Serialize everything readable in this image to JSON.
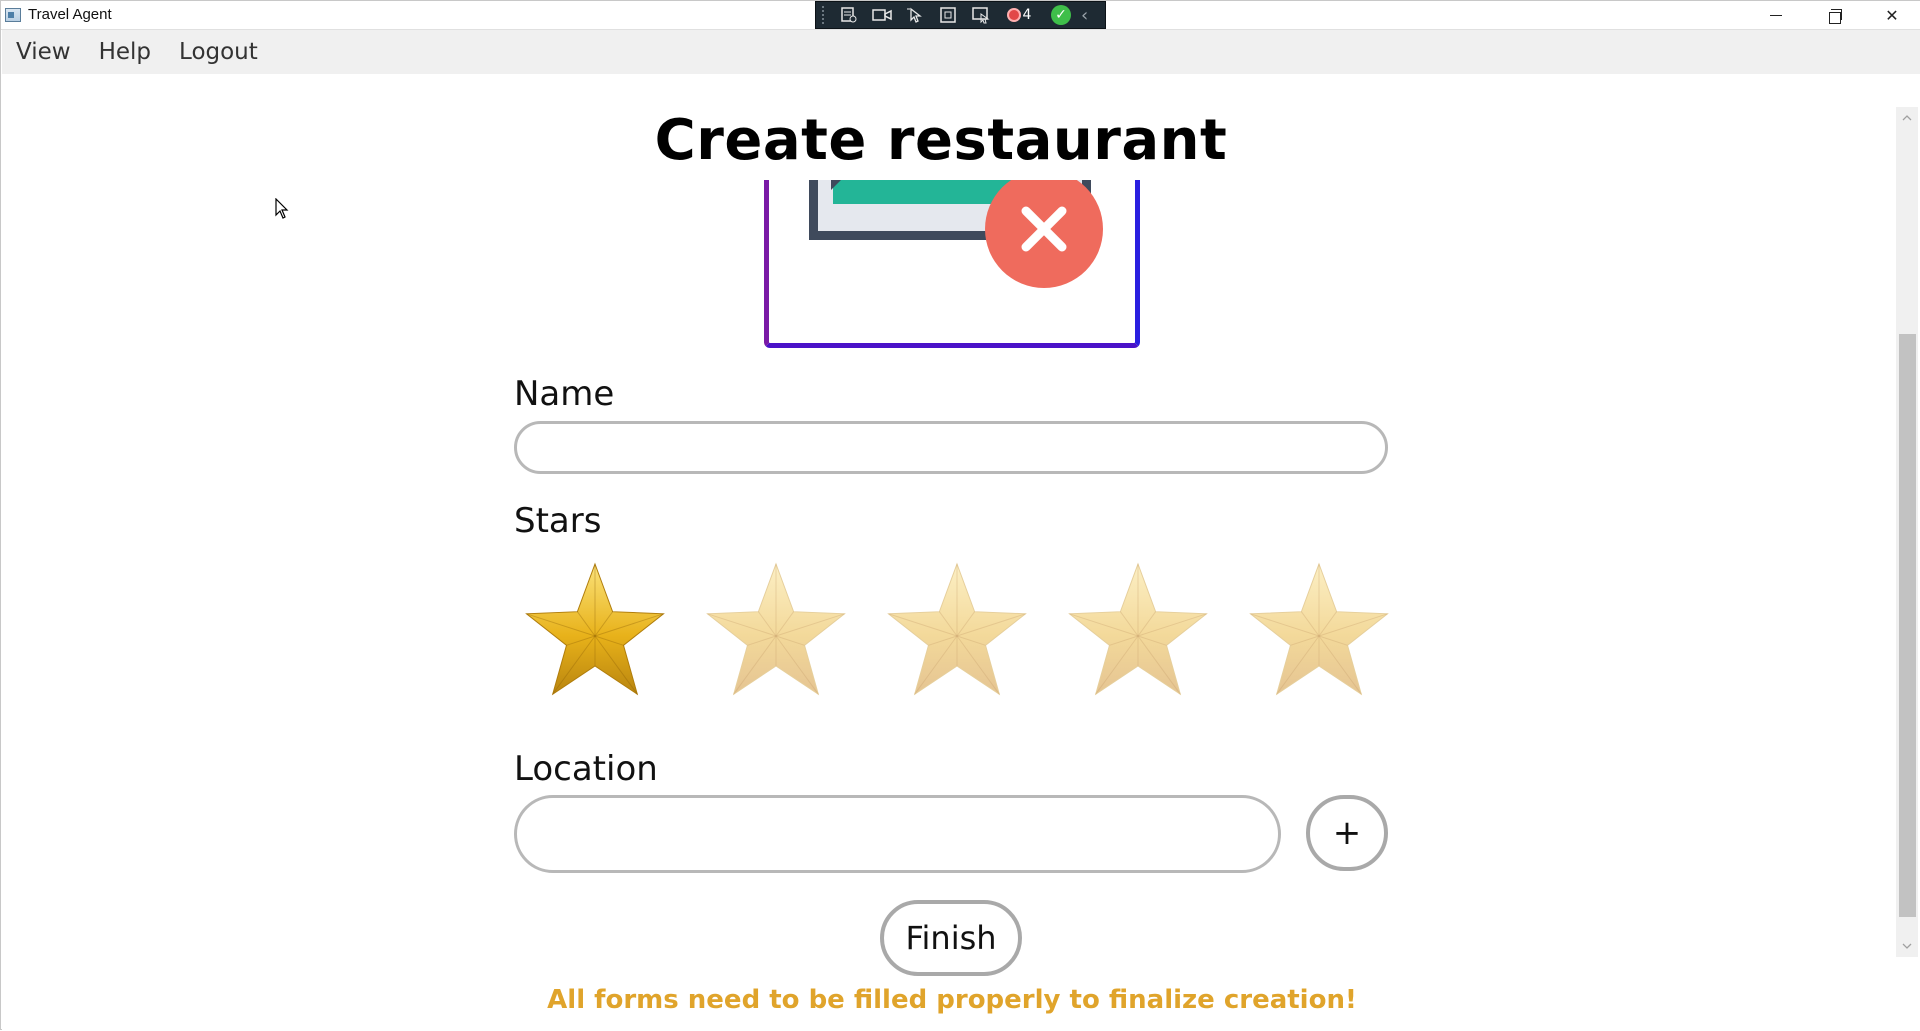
{
  "window": {
    "title": "Travel Agent",
    "close_glyph": "✕"
  },
  "capture_toolbar": {
    "recording_count": "4",
    "confirm_glyph": "✓",
    "collapse_glyph": "‹"
  },
  "menu": {
    "items": [
      "View",
      "Help",
      "Logout"
    ]
  },
  "page": {
    "title": "Create restaurant"
  },
  "form": {
    "name_label": "Name",
    "name_value": "",
    "stars_label": "Stars",
    "stars": {
      "max": 5,
      "selected": 1
    },
    "location_label": "Location",
    "location_value": "",
    "add_location_label": "+",
    "finish_label": "Finish",
    "error_message": "All forms need to be filled properly to finalize creation!"
  },
  "colors": {
    "error_text": "#e0a42b",
    "star_active": "#e8b21a",
    "star_inactive": "#f3d99a",
    "frame_start": "#7a1aa6",
    "frame_end": "#2a1fe0",
    "badge": "#ef6b5d"
  },
  "icons": {
    "image_placeholder": "image-error-icon",
    "star": "star-icon",
    "add": "plus-icon"
  }
}
